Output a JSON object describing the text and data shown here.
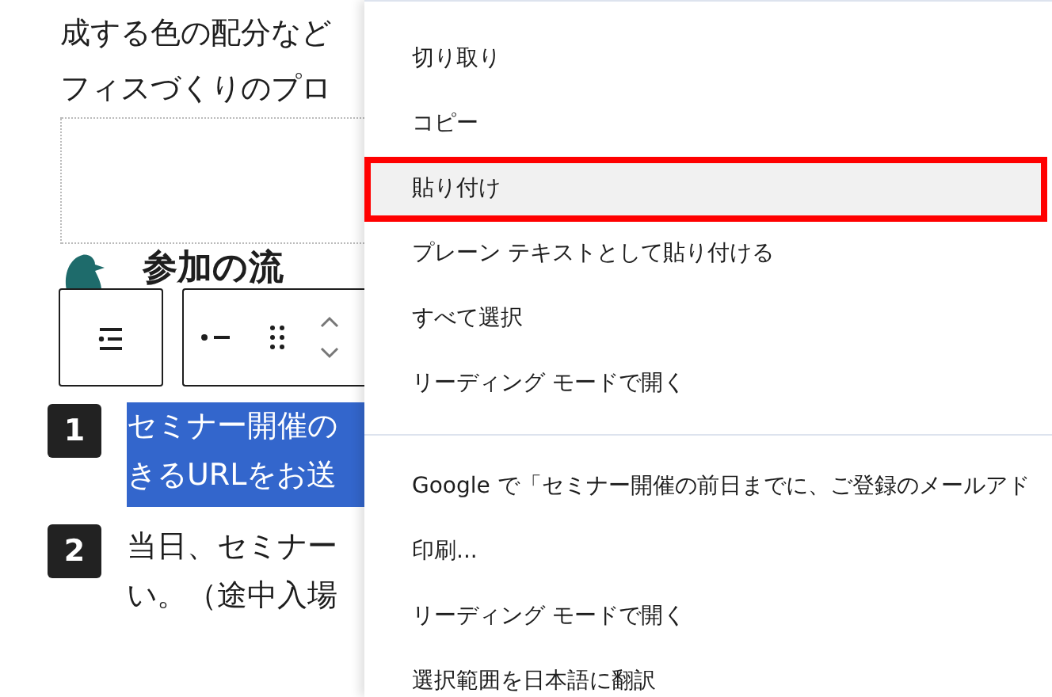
{
  "page": {
    "paragraph_lines": [
      "成する色の配分など",
      "フィスづくりのプロ"
    ],
    "heading": "参加の流",
    "steps": [
      {
        "number": "1",
        "lines": [
          "セミナー開催の",
          "きるURLをお送"
        ],
        "selected": true
      },
      {
        "number": "2",
        "lines": [
          "当日、セミナー",
          "い。（途中入場"
        ],
        "selected": false
      }
    ]
  },
  "context_menu": {
    "groups": [
      [
        {
          "label": "切り取り",
          "hovered": false
        },
        {
          "label": "コピー",
          "hovered": false
        },
        {
          "label": "貼り付け",
          "hovered": true
        },
        {
          "label": "プレーン テキストとして貼り付ける",
          "hovered": false
        },
        {
          "label": "すべて選択",
          "hovered": false
        },
        {
          "label": "リーディング モードで開く",
          "hovered": false
        }
      ],
      [
        {
          "label": "Google で「セミナー開催の前日までに、ご登録のメールアド",
          "hovered": false
        },
        {
          "label": "印刷...",
          "hovered": false
        },
        {
          "label": "リーディング モードで開く",
          "hovered": false
        },
        {
          "label": "選択範囲を日本語に翻訳",
          "hovered": false
        }
      ]
    ]
  }
}
